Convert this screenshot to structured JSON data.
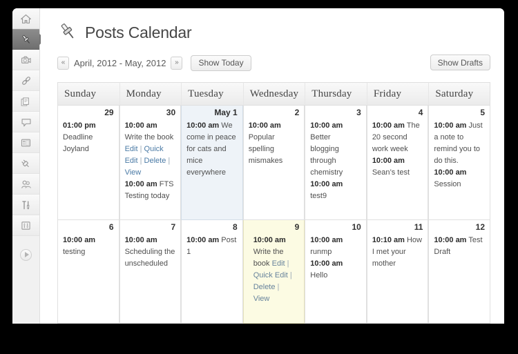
{
  "window": {
    "background_color": "#000000",
    "page_background": "#ffffff"
  },
  "sidebar": {
    "items": [
      {
        "name": "dashboard",
        "icon": "home-icon",
        "active": false
      },
      {
        "name": "posts",
        "icon": "pin-icon",
        "active": true
      },
      {
        "name": "media",
        "icon": "camera-icon",
        "active": false
      },
      {
        "name": "links",
        "icon": "link-icon",
        "active": false
      },
      {
        "name": "pages",
        "icon": "pages-icon",
        "active": false
      },
      {
        "name": "comments",
        "icon": "comment-bubble-icon",
        "active": false
      },
      {
        "name": "appearance",
        "icon": "layout-icon",
        "active": false
      },
      {
        "name": "plugins",
        "icon": "plug-icon",
        "active": false
      },
      {
        "name": "users",
        "icon": "users-icon",
        "active": false
      },
      {
        "name": "tools",
        "icon": "tools-icon",
        "active": false
      },
      {
        "name": "settings",
        "icon": "sliders-icon",
        "active": false
      }
    ],
    "collapse": {
      "icon": "collapse-arrow-icon"
    }
  },
  "header": {
    "title": "Posts Calendar",
    "title_icon": "pushpin-icon"
  },
  "toolbar": {
    "prev_label": "«",
    "next_label": "»",
    "range_label": "April, 2012 - May, 2012",
    "show_today_label": "Show Today",
    "show_drafts_label": "Show Drafts"
  },
  "calendar": {
    "weekdays": [
      "Sunday",
      "Monday",
      "Tuesday",
      "Wednesday",
      "Thursday",
      "Friday",
      "Saturday"
    ],
    "colors": {
      "month_start_bg": "#eef3f8",
      "today_bg": "#fcfbe3",
      "link": "#4a7aa5",
      "header_bg": "#f0f0f0"
    },
    "weeks": [
      [
        {
          "daynum": "29",
          "state": "normal",
          "events": [
            {
              "time": "01:00 pm",
              "title": "Deadline Joyland",
              "links": []
            }
          ]
        },
        {
          "daynum": "30",
          "state": "normal",
          "events": [
            {
              "time": "10:00 am",
              "title": "Write the book",
              "links": [
                "Edit",
                "Quick Edit",
                "Delete",
                "View"
              ]
            },
            {
              "time": "10:00 am",
              "title": "FTS Testing today",
              "links": []
            }
          ]
        },
        {
          "daynum": "May 1",
          "state": "month-start",
          "events": [
            {
              "time": "10:00 am",
              "title": "We come in peace for cats and mice everywhere",
              "links": []
            }
          ]
        },
        {
          "daynum": "2",
          "state": "normal",
          "events": [
            {
              "time": "10:00 am",
              "title": "Popular spelling mismakes",
              "links": []
            }
          ]
        },
        {
          "daynum": "3",
          "state": "normal",
          "events": [
            {
              "time": "10:00 am",
              "title": "Better blogging through chemistry",
              "links": []
            },
            {
              "time": "10:00 am",
              "title": "test9",
              "links": []
            }
          ]
        },
        {
          "daynum": "4",
          "state": "normal",
          "events": [
            {
              "time": "10:00 am",
              "title": "The 20 second work week",
              "links": []
            },
            {
              "time": "10:00 am",
              "title": "Sean’s test",
              "links": []
            }
          ]
        },
        {
          "daynum": "5",
          "state": "normal",
          "events": [
            {
              "time": "10:00 am",
              "title": "Just a note to remind you to do this.",
              "links": []
            },
            {
              "time": "10:00 am",
              "title": "Session",
              "links": []
            }
          ]
        }
      ],
      [
        {
          "daynum": "6",
          "state": "normal",
          "events": [
            {
              "time": "10:00 am",
              "title": "testing",
              "links": []
            }
          ]
        },
        {
          "daynum": "7",
          "state": "normal",
          "events": [
            {
              "time": "10:00 am",
              "title": "Scheduling the unscheduled",
              "links": []
            }
          ]
        },
        {
          "daynum": "8",
          "state": "normal",
          "events": [
            {
              "time": "10:00 am",
              "title": "Post 1",
              "links": []
            }
          ]
        },
        {
          "daynum": "9",
          "state": "today",
          "events": [
            {
              "time": "10:00 am",
              "title": "Write the book",
              "links": [
                "Edit",
                "Quick Edit",
                "Delete",
                "View"
              ]
            }
          ]
        },
        {
          "daynum": "10",
          "state": "normal",
          "events": [
            {
              "time": "10:00 am",
              "title": "runmp",
              "links": []
            },
            {
              "time": "10:00 am",
              "title": "Hello",
              "links": []
            }
          ]
        },
        {
          "daynum": "11",
          "state": "normal",
          "events": [
            {
              "time": "10:10 am",
              "title": "How I met your mother",
              "links": []
            }
          ]
        },
        {
          "daynum": "12",
          "state": "normal",
          "events": [
            {
              "time": "10:00 am",
              "title": "Test Draft",
              "links": []
            }
          ]
        }
      ]
    ]
  }
}
